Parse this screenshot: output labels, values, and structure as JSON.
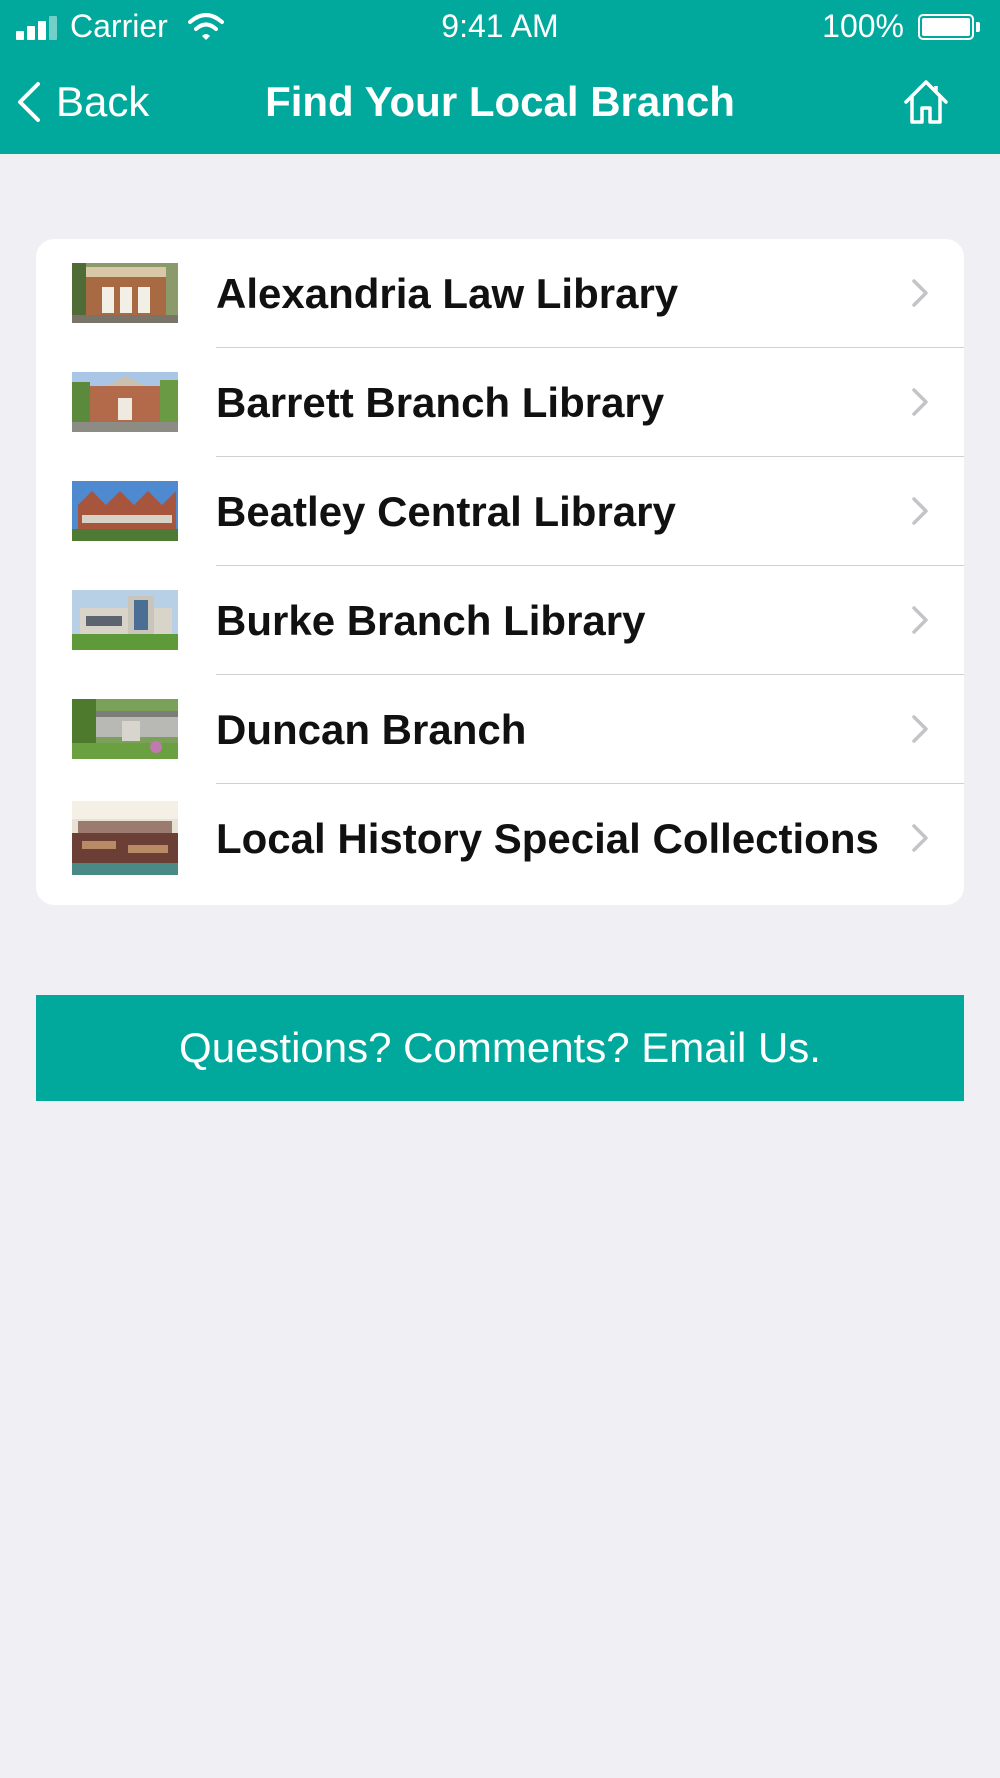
{
  "status_bar": {
    "carrier": "Carrier",
    "time": "9:41 AM",
    "battery": "100%"
  },
  "nav": {
    "back_label": "Back",
    "title": "Find Your Local Branch",
    "home_icon": "home-icon"
  },
  "branches": [
    {
      "label": "Alexandria Law Library"
    },
    {
      "label": "Barrett Branch Library"
    },
    {
      "label": "Beatley Central Library"
    },
    {
      "label": "Burke Branch Library"
    },
    {
      "label": "Duncan Branch"
    },
    {
      "label": "Local History Special Collections"
    }
  ],
  "email_button": {
    "label": "Questions? Comments? Email Us."
  },
  "colors": {
    "accent": "#00a99c",
    "background": "#efeff4",
    "card": "#ffffff",
    "chevron": "#c4c4c8"
  }
}
